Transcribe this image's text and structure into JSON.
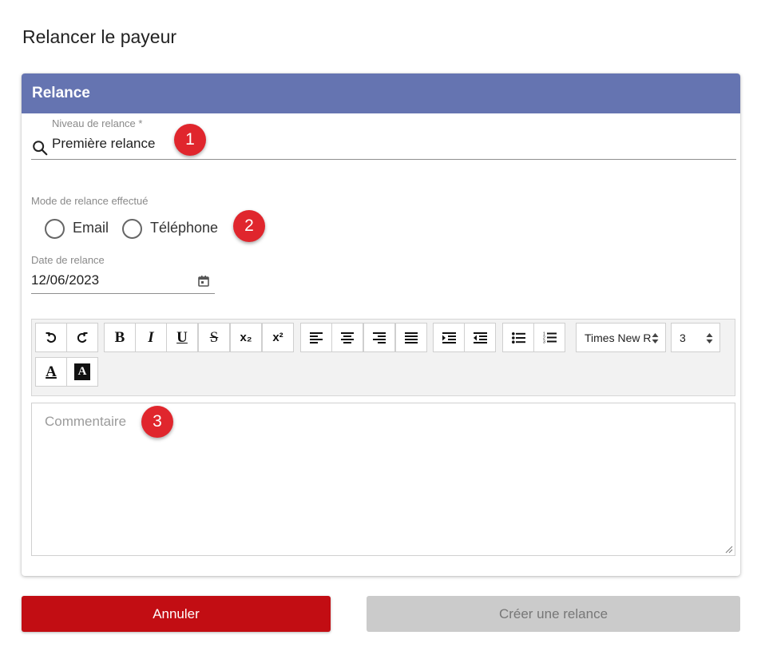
{
  "page": {
    "title": "Relancer le payeur"
  },
  "card": {
    "header": "Relance",
    "level_field": {
      "label": "Niveau de relance *",
      "value": "Première relance",
      "icon": "search-icon"
    },
    "mode_field": {
      "label": "Mode de relance effectué",
      "options": [
        "Email",
        "Téléphone"
      ],
      "selected": null
    },
    "date_field": {
      "label": "Date de relance",
      "value": "12/06/2023",
      "icon": "calendar-icon"
    },
    "toolbar": {
      "buttons": [
        "undo",
        "redo",
        "bold",
        "italic",
        "underline",
        "strikethrough",
        "subscript",
        "superscript",
        "align-left",
        "align-center",
        "align-right",
        "justify",
        "indent",
        "outdent",
        "bullet-list",
        "numbered-list",
        "font-color",
        "highlight-color"
      ],
      "bold_label": "B",
      "italic_label": "I",
      "underline_label": "U",
      "strike_label": "S",
      "subscript_label": "x₂",
      "superscript_label": "x²",
      "font_family": "Times New R",
      "font_size": "3",
      "font_color_label": "A",
      "highlight_label": "A"
    },
    "comment": {
      "placeholder": "Commentaire"
    }
  },
  "badges": [
    "1",
    "2",
    "3"
  ],
  "actions": {
    "cancel_label": "Annuler",
    "create_label": "Créer une relance"
  },
  "colors": {
    "header": "#6574b1",
    "cancel": "#c20d13",
    "badge": "#e0262d",
    "disabled_button": "#cbcbcb"
  }
}
